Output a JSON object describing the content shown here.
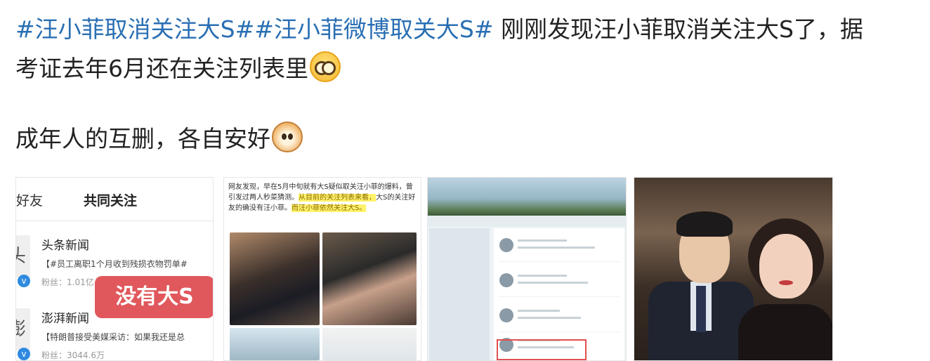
{
  "post": {
    "hashtag1": "#汪小菲取消关注大S#",
    "hashtag2": "#汪小菲微博取关大S#",
    "line1_text": " 刚刚发现汪小菲取消关注大S了，据",
    "line2_text": "考证去年6月还在关注列表里",
    "line2_emoji": "glasses-face-emoji",
    "line3_text": "成年人的互删，各自安好",
    "line3_emoji": "cat-face-emoji"
  },
  "thumbs": [
    {
      "id": "common-follows-screenshot",
      "header_left": "好友",
      "header_title": "共同关注",
      "rows": [
        {
          "avatar": "头",
          "name": "头条新闻",
          "desc": "【#员工离职1个月收到残损衣物罚单#",
          "fans": "粉丝：1.01亿"
        },
        {
          "avatar": "澎",
          "name": "澎湃新闻",
          "desc": "【特朗普接受美媒采访：如果我还是总",
          "fans": "粉丝：3044.6万"
        }
      ],
      "overlay": "没有大S"
    },
    {
      "id": "article-screenshot",
      "article_plain": "网友发现，早在5月中旬就有大S疑似取关汪小菲的爆料，曾引发过两人秒菜猜测。",
      "article_highlight1": "从目前的关注列表来看，",
      "article_plain2": "大S的关注好友的确没有汪小菲。",
      "article_highlight2": "而汪小菲依然关注大S。"
    },
    {
      "id": "follow-list-screenshot"
    },
    {
      "id": "couple-photo"
    }
  ],
  "colors": {
    "hashtag": "#2a6fb3",
    "overlay": "#e0585c",
    "highlight": "#fff26a"
  }
}
